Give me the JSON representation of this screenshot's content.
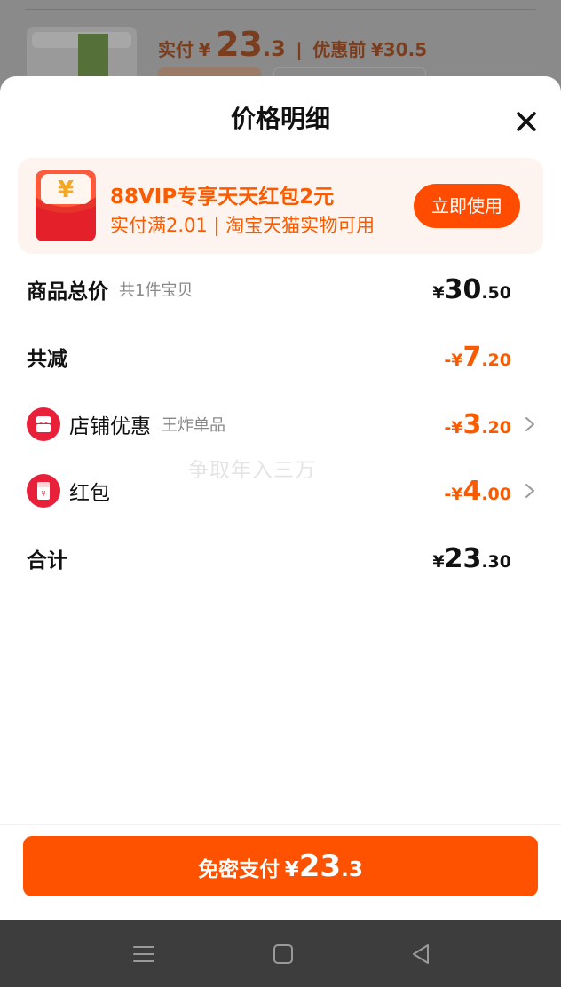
{
  "background_item": {
    "paid_label": "实付",
    "currency": "¥",
    "paid_int": "23",
    "paid_dec": ".3",
    "separator": "|",
    "before_label": "优惠前",
    "before_price": "¥30.5"
  },
  "sheet": {
    "title": "价格明细"
  },
  "promo": {
    "title": "88VIP专享天天红包2元",
    "subtitle": "实付满2.01 | 淘宝天猫实物可用",
    "button": "立即使用",
    "icon": "red-envelope-icon"
  },
  "rows": {
    "total": {
      "label": "商品总价",
      "hint": "共1件宝贝",
      "currency": "¥",
      "int": "30",
      "dec": ".50"
    },
    "discount": {
      "label": "共减",
      "currency": "-¥",
      "int": "7",
      "dec": ".20"
    },
    "store": {
      "label": "店铺优惠",
      "hint": "王炸单品",
      "currency": "-¥",
      "int": "3",
      "dec": ".20",
      "icon": "store-icon"
    },
    "redpacket": {
      "label": "红包",
      "currency": "-¥",
      "int": "4",
      "dec": ".00",
      "icon": "red-envelope-icon"
    },
    "sum": {
      "label": "合计",
      "currency": "¥",
      "int": "23",
      "dec": ".30"
    }
  },
  "watermark": "争取年入三万",
  "pay": {
    "label": "免密支付",
    "currency": "¥",
    "int": "23",
    "dec": ".3"
  },
  "navbar": {
    "icons": [
      "menu-icon",
      "home-square-icon",
      "back-triangle-icon"
    ]
  },
  "colors": {
    "accent": "#ff5200",
    "orange_text": "#fa5a00",
    "nav_bg": "#3d3d3d"
  }
}
